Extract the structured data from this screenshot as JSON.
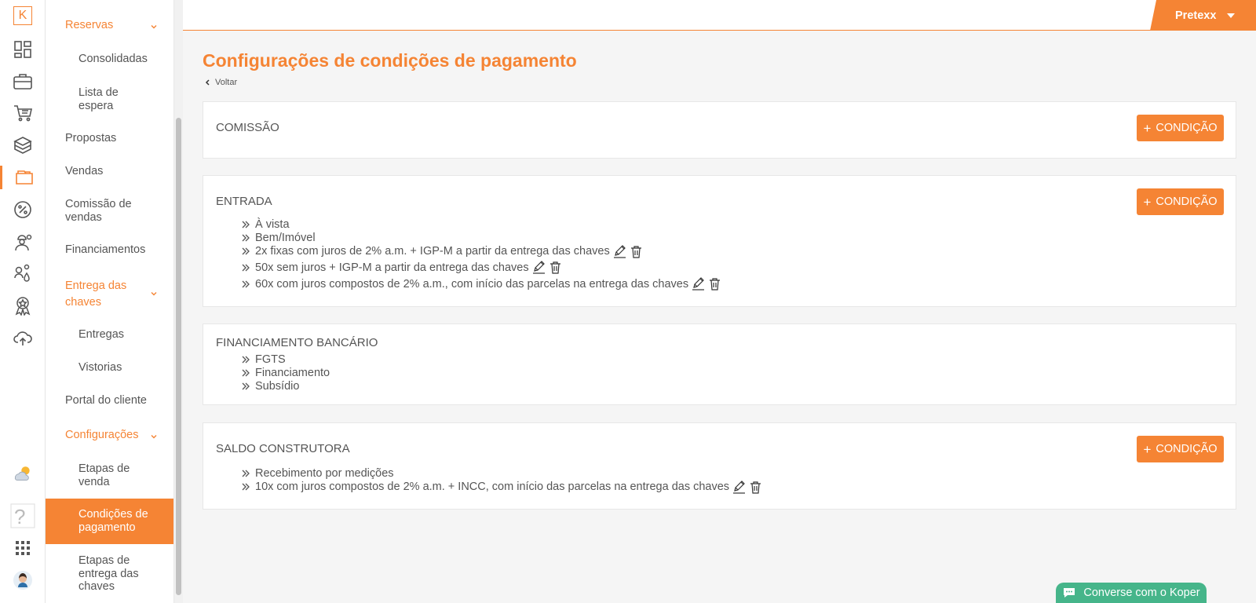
{
  "rail": {
    "logo_letter": "K",
    "icons": [
      "dashboard-icon",
      "briefcase-icon",
      "cart-icon",
      "boxes-icon",
      "folder-icon",
      "percent-icon",
      "engineer-icon",
      "people-icon",
      "award-icon",
      "cloud-upload-icon",
      "weather-icon",
      "help-icon",
      "apps-icon",
      "avatar"
    ]
  },
  "menu": {
    "items": [
      {
        "label": "Reservas",
        "expanded": true
      },
      {
        "label": "Consolidadas"
      },
      {
        "label": "Lista de espera"
      },
      {
        "label": "Propostas"
      },
      {
        "label": "Vendas"
      },
      {
        "label": "Comissão de vendas"
      },
      {
        "label": "Financiamentos"
      },
      {
        "label": "Entrega das chaves",
        "expanded": true
      },
      {
        "label": "Entregas"
      },
      {
        "label": "Vistorias"
      },
      {
        "label": "Portal do cliente"
      },
      {
        "label": "Configurações",
        "expanded": true
      },
      {
        "label": "Etapas de venda"
      },
      {
        "label": "Condições de pagamento",
        "selected": true
      },
      {
        "label": "Etapas de entrega das chaves"
      }
    ]
  },
  "topbar": {
    "user": "Pretexx"
  },
  "page": {
    "title": "Configurações de condições de pagamento",
    "back": "Voltar"
  },
  "button": {
    "add_condition": "CONDIÇÃO"
  },
  "sections": [
    {
      "title": "COMISSÃO",
      "items": []
    },
    {
      "title": "ENTRADA",
      "items": [
        "À vista",
        "Bem/Imóvel",
        "2x fixas com juros de 2% a.m. + IGP-M a partir da entrega das chaves",
        "50x sem juros + IGP-M a partir da entrega das chaves",
        "60x com juros compostos de 2% a.m., com início das parcelas na entrega das chaves"
      ]
    },
    {
      "title": "FINANCIAMENTO BANCÁRIO",
      "items": [
        "FGTS",
        "Financiamento",
        "Subsídio"
      ]
    },
    {
      "title": "SALDO CONSTRUTORA",
      "items": [
        "Recebimento por medições",
        "10x com juros compostos de 2% a.m. + INCC, com início das parcelas na entrega das chaves"
      ]
    }
  ],
  "chat": {
    "label": "Converse com o Koper"
  },
  "colors": {
    "accent": "#f58434",
    "chat": "#46b58a"
  }
}
